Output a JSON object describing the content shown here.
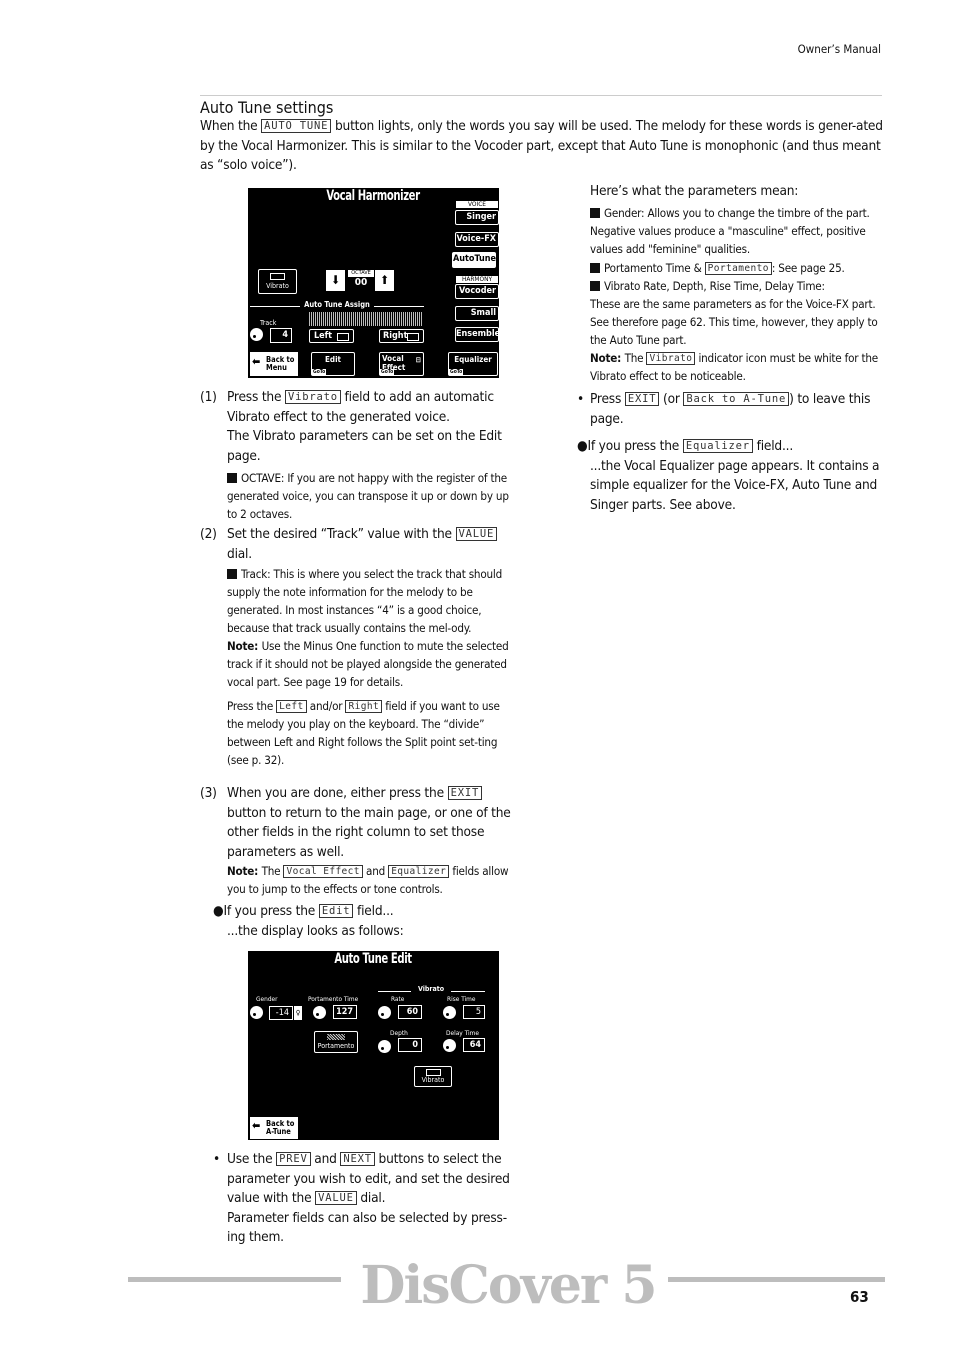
{
  "header": {
    "manual": "Owner’s Manual"
  },
  "section_title": "Auto Tune settings",
  "intro": [
    {
      "t": "When the "
    },
    {
      "k": "AUTO TUNE"
    },
    {
      "t": " button lights, only the words you say will be used. The melody for these words is gener-ated by the Vocal Harmonizer. This is similar to the Vocoder part, except that Auto Tune is monophonic (and thus meant as “solo voice”)."
    }
  ],
  "lcd1": {
    "title": "Vocal Harmonizer",
    "voice_label": "VOICE",
    "harmony_label": "HARMONY",
    "singer": "Singer",
    "voicefx": "Voice-FX",
    "autotune": "AutoTune",
    "vocoder": "Vocoder",
    "small": "Small",
    "ensemble": "Ensemble",
    "vibrato": "Vibrato",
    "octave_label": "OCTAVE",
    "octave_value": "00",
    "assign_label": "Auto Tune Assign",
    "track_label": "Track",
    "track_value": "4",
    "left": "Left",
    "right": "Right",
    "back": "Back to Menu",
    "edit": "Edit",
    "vocal_effect": "Vocal Effect",
    "equalizer": "Equalizer",
    "goto": "GoTo"
  },
  "steps": [
    {
      "num": "(1)",
      "text": [
        {
          "t": "Press the "
        },
        {
          "k": "Vibrato"
        },
        {
          "t": " field to add an automatic Vibrato effect to the generated voice."
        }
      ],
      "sub": [
        {
          "t": "The Vibrato parameters can be set on the Edit page."
        }
      ],
      "small": [
        {
          "sq": 1
        },
        {
          "t": "OCTAVE: "
        },
        {
          "t": "If you are not happy with the register of the generated voice, you can transpose it up or down by up to 2 octaves."
        }
      ]
    },
    {
      "num": "(2)",
      "text": [
        {
          "t": "Set the desired “Track” value with the "
        },
        {
          "k": "VALUE"
        },
        {
          "t": " dial."
        }
      ],
      "small": [
        {
          "sq": 1
        },
        {
          "t": "Track: "
        },
        {
          "t": "This is where you select the track that should supply the note information for the melody to be generated. In most instances “4” is a good choice, because that track usually contains the mel-ody."
        }
      ],
      "note": [
        {
          "b": "Note: "
        },
        {
          "t": "Use the Minus One function to mute the selected track if it should not be played alongside the generated vocal part. See page 19 for details."
        }
      ],
      "small2": [
        {
          "t": "Press the "
        },
        {
          "k": "Left"
        },
        {
          "t": " and/or "
        },
        {
          "k": "Right"
        },
        {
          "t": " field if you want to use the melody you play on the keyboard. The “divide” between Left and Right follows the Split point set-ting (see p. 32)."
        }
      ]
    },
    {
      "num": "(3)",
      "text": [
        {
          "t": "When you are done, either press the "
        },
        {
          "k": "EXIT"
        },
        {
          "t": " button to return to the main page, or one of the other fields in the right column to set those parameters as well."
        }
      ],
      "note": [
        {
          "b": "Note: "
        },
        {
          "t": "The "
        },
        {
          "k": "Vocal Effect"
        },
        {
          "t": " and "
        },
        {
          "k": "Equalizer"
        },
        {
          "t": " fields allow you to jump to the effects or tone controls."
        }
      ]
    }
  ],
  "edit_field": {
    "text": [
      {
        "t": "●If you press the "
      },
      {
        "k": "Edit"
      },
      {
        "t": " field..."
      }
    ],
    "sub": "...the display looks as follows:"
  },
  "lcd2": {
    "title": "Auto Tune  Edit",
    "vibrato_group": "Vibrato",
    "gender": "Gender",
    "gender_value": "-14",
    "portamento_time": "Portamento Time",
    "portamento_value": "127",
    "rate": "Rate",
    "rate_value": "60",
    "rise_time": "Rise Time",
    "rise_value": "5",
    "portamento": "Portamento",
    "depth": "Depth",
    "depth_value": "0",
    "delay_time": "Delay Time",
    "delay_value": "64",
    "vibrato": "Vibrato",
    "back": "Back to A-Tune"
  },
  "bullet_prev": {
    "text": [
      {
        "t": "Use the "
      },
      {
        "k": "PREV"
      },
      {
        "t": " and "
      },
      {
        "k": "NEXT"
      },
      {
        "t": " buttons to select the parameter you wish to edit, and set the desired value with the "
      },
      {
        "k": "VALUE"
      },
      {
        "t": " dial."
      }
    ],
    "sub": "Parameter fields can also be selected by press-ing them."
  },
  "right": {
    "intro": "Here’s what the parameters mean:",
    "gender": [
      {
        "sq": 1
      },
      {
        "t": "Gender: "
      },
      {
        "t": "Allows you to change the timbre of the part. Negative values produce a \"masculine\" effect, positive values add \"feminine\" qualities."
      }
    ],
    "portamento": [
      {
        "sq": 1
      },
      {
        "t": "Portamento Time & "
      },
      {
        "k": "Portamento"
      },
      {
        "t": ": See page 25."
      }
    ],
    "vibrato": [
      {
        "sq": 1
      },
      {
        "t": "Vibrato Rate, Depth, Rise Time, Delay Time:"
      },
      {
        "br": 1
      },
      {
        "t": "These are the same parameters as for the Voice-FX part. See therefore page 62. This time, however, they apply to the Auto Tune part."
      }
    ],
    "note": [
      {
        "b": "Note: "
      },
      {
        "t": "The "
      },
      {
        "k": "Vibrato"
      },
      {
        "t": " indicator icon must be white for the Vibrato effect to be noticeable."
      }
    ],
    "exit": [
      {
        "t": "Press "
      },
      {
        "k": "EXIT"
      },
      {
        "t": " (or "
      },
      {
        "k": "Back to A-Tune"
      },
      {
        "t": ") to leave this page."
      }
    ],
    "eq": [
      {
        "t": "●If you press the "
      },
      {
        "k": "Equalizer"
      },
      {
        "t": " field..."
      }
    ],
    "eq_sub": "...the Vocal Equalizer page appears. It contains a simple equalizer for the Voice-FX, Auto Tune and Singer parts. See above."
  },
  "footer": {
    "logo": "DisCover 5",
    "page": "63",
    "rule_color": "#bdbdbd"
  }
}
